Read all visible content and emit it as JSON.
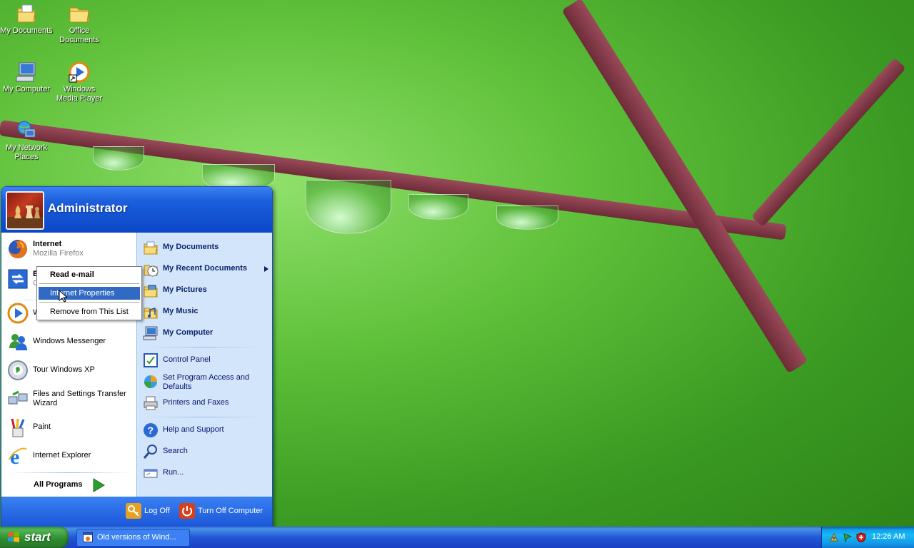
{
  "desktop": {
    "icons": [
      {
        "label": "My Documents",
        "icon": "my-documents-icon"
      },
      {
        "label": "Office Documents",
        "icon": "folder-icon"
      },
      {
        "label": "My Computer",
        "icon": "my-computer-icon"
      },
      {
        "label": "Windows Media Player",
        "icon": "media-player-icon"
      },
      {
        "label": "My Network Places",
        "icon": "network-places-icon"
      }
    ]
  },
  "start_menu": {
    "user_name": "Administrator",
    "pinned": [
      {
        "title": "Internet",
        "subtitle": "Mozilla Firefox",
        "icon": "firefox-icon"
      },
      {
        "title": "E",
        "subtitle": "O",
        "icon": "email-icon"
      }
    ],
    "recent": [
      {
        "label": "W",
        "icon": "media-player-icon"
      },
      {
        "label": "Windows Messenger",
        "icon": "messenger-icon"
      },
      {
        "label": "Tour Windows XP",
        "icon": "tour-icon"
      },
      {
        "label": "Files and Settings Transfer Wizard",
        "icon": "transfer-wizard-icon"
      },
      {
        "label": "Paint",
        "icon": "paint-icon"
      },
      {
        "label": "Internet Explorer",
        "icon": "internet-explorer-icon"
      }
    ],
    "all_programs": "All Programs",
    "right_bold": [
      {
        "label": "My Documents",
        "icon": "my-documents-icon"
      },
      {
        "label": "My Recent Documents",
        "icon": "recent-documents-icon"
      },
      {
        "label": "My Pictures",
        "icon": "my-pictures-icon"
      },
      {
        "label": "My Music",
        "icon": "my-music-icon"
      },
      {
        "label": "My Computer",
        "icon": "my-computer-icon"
      }
    ],
    "right_mid": [
      {
        "label": "Control Panel",
        "icon": "control-panel-icon"
      },
      {
        "label": "Set Program Access and Defaults",
        "icon": "program-access-icon"
      },
      {
        "label": "Printers and Faxes",
        "icon": "printer-icon"
      }
    ],
    "right_bottom": [
      {
        "label": "Help and Support",
        "icon": "help-icon"
      },
      {
        "label": "Search",
        "icon": "search-icon"
      },
      {
        "label": "Run...",
        "icon": "run-icon"
      }
    ],
    "footer": {
      "log_off": "Log Off",
      "turn_off": "Turn Off Computer"
    }
  },
  "context_menu": {
    "items": [
      {
        "label": "Read e-mail",
        "default": true
      },
      {
        "label": "Internet Properties",
        "highlighted": true
      },
      {
        "label": "Remove from This List"
      }
    ]
  },
  "taskbar": {
    "start_label": "start",
    "task": "Old versions of Wind...",
    "clock": "12:26 AM"
  },
  "colors": {
    "taskbar_blue": "#2157d7",
    "start_green": "#3c9a3c",
    "menu_blue": "#1c5fdc",
    "highlight": "#316ac5"
  }
}
